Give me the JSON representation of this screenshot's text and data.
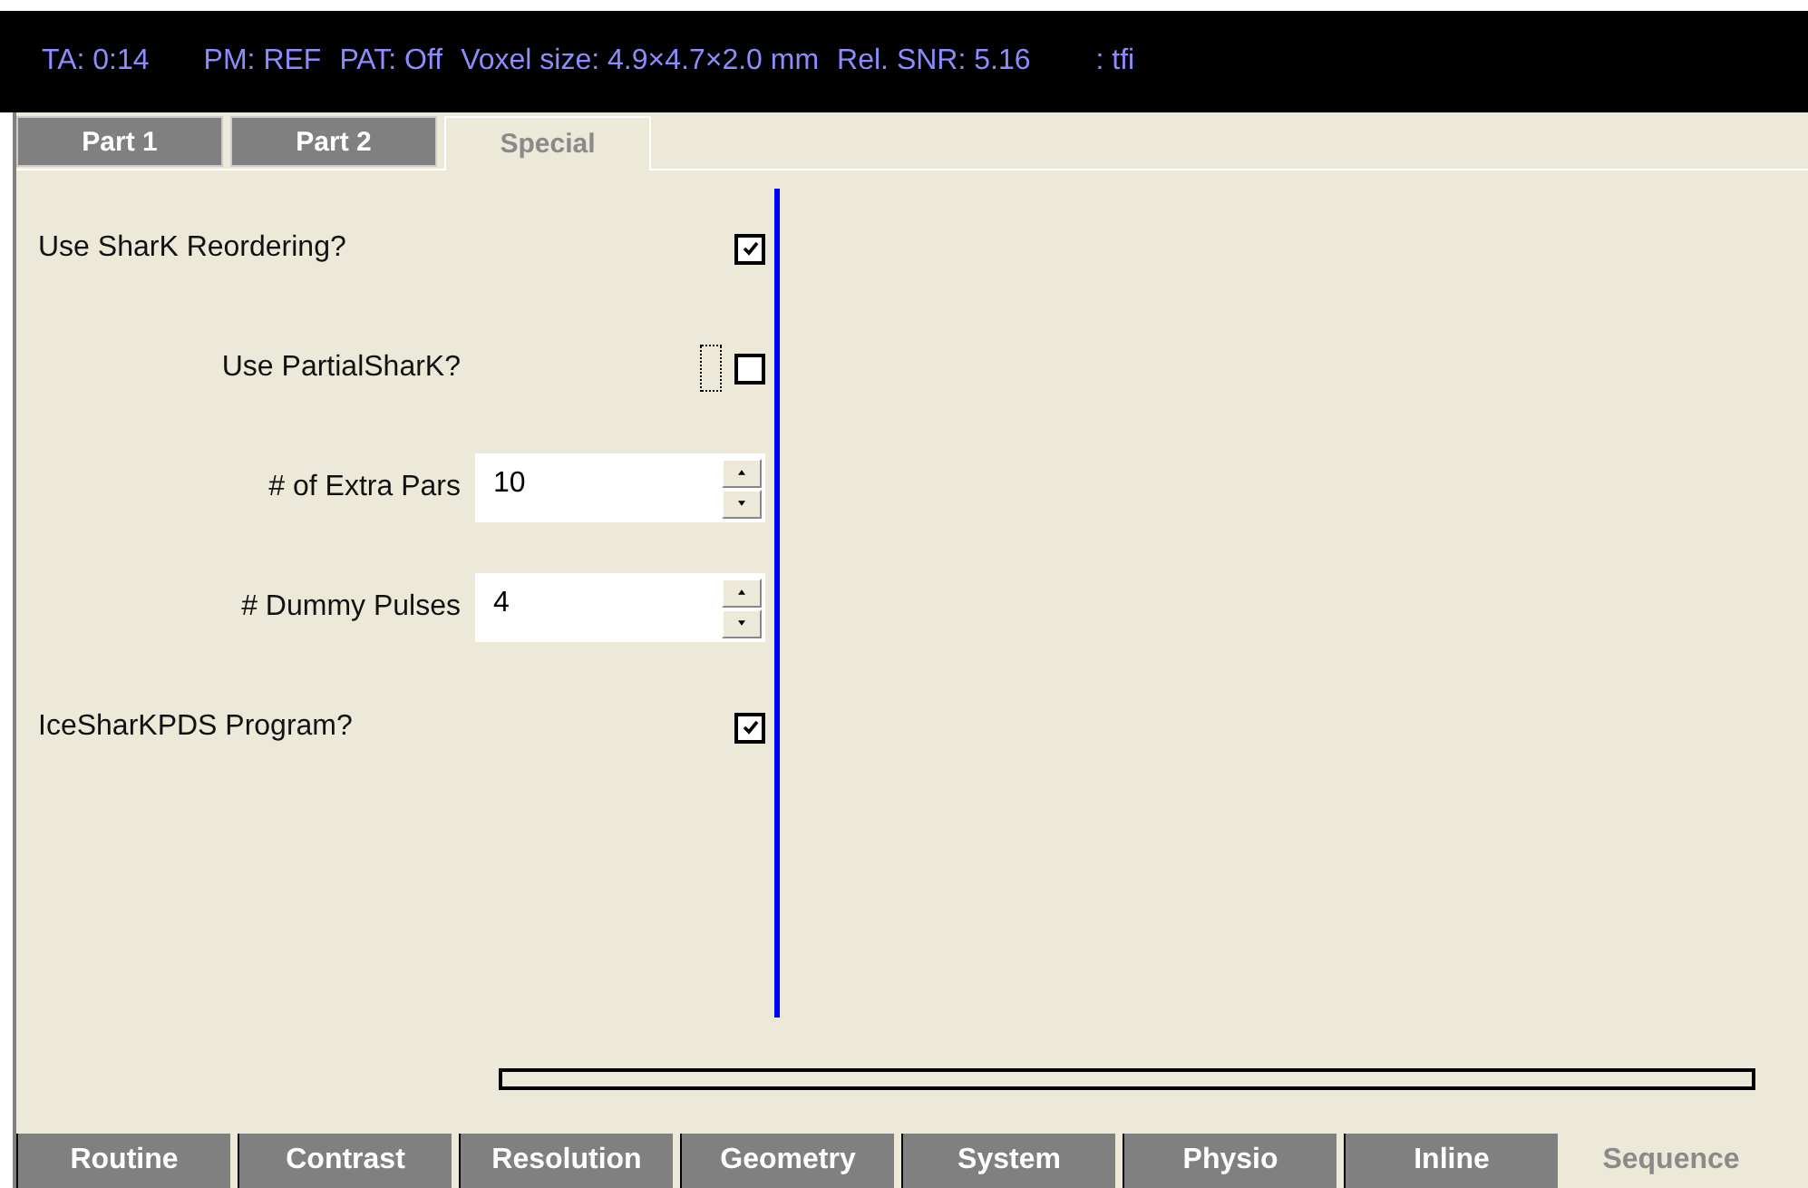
{
  "header": [
    "TA: 0:14",
    "PM: REF",
    "PAT: Off",
    "Voxel size: 4.9×4.7×2.0 mm",
    "Rel. SNR: 5.16",
    ": tfi"
  ],
  "tabs": [
    {
      "label": "Part 1",
      "selected": false
    },
    {
      "label": "Part 2",
      "selected": false
    },
    {
      "label": "Special",
      "selected": true
    }
  ],
  "params": [
    {
      "kind": "checkbox",
      "label": "Use SharK Reordering?",
      "checked": true,
      "focused": false
    },
    {
      "kind": "checkbox",
      "label": "Use PartialSharK?",
      "checked": false,
      "focused": true
    },
    {
      "kind": "spinner",
      "label": "# of Extra Pars",
      "value": "10"
    },
    {
      "kind": "spinner",
      "label": "# Dummy Pulses",
      "value": "4"
    },
    {
      "kind": "checkbox",
      "label": "IceSharKPDS Program?",
      "checked": true,
      "focused": false
    }
  ],
  "bottom_tabs": [
    {
      "label": "Routine",
      "selected": false
    },
    {
      "label": "Contrast",
      "selected": false
    },
    {
      "label": "Resolution",
      "selected": false
    },
    {
      "label": "Geometry",
      "selected": false
    },
    {
      "label": "System",
      "selected": false
    },
    {
      "label": "Physio",
      "selected": false
    },
    {
      "label": "Inline",
      "selected": false
    },
    {
      "label": "Sequence",
      "selected": true
    }
  ]
}
